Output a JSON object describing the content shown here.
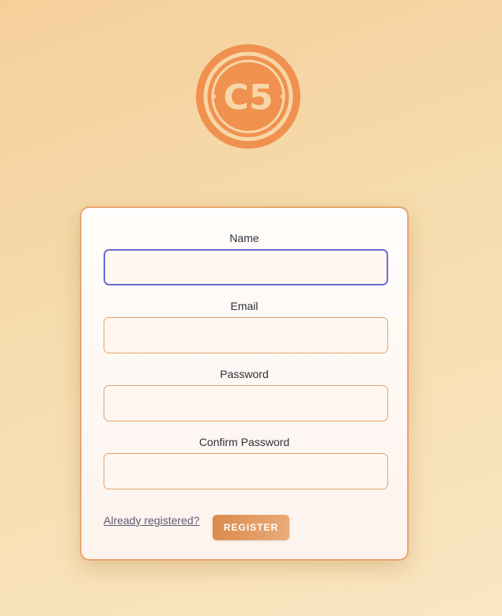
{
  "logo": {
    "text": "C5",
    "color": "#f0914f",
    "accent": "#f8d7a6"
  },
  "form": {
    "fields": [
      {
        "label": "Name",
        "value": "",
        "focused": true
      },
      {
        "label": "Email",
        "value": "",
        "focused": false
      },
      {
        "label": "Password",
        "value": "",
        "focused": false
      },
      {
        "label": "Confirm Password",
        "value": "",
        "focused": false
      }
    ],
    "already_registered_link": "Already registered?",
    "register_button": "REGISTER"
  },
  "colors": {
    "focus_border": "#6b6bd6",
    "input_border": "#e0a56f",
    "card_border": "#e6a56c",
    "button": "#dc8a4c"
  }
}
